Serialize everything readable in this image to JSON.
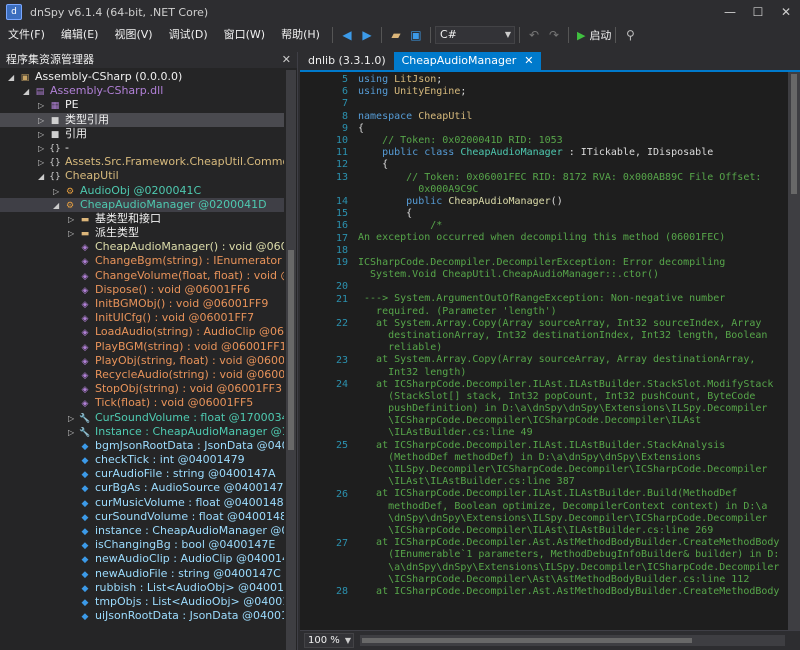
{
  "window": {
    "title": "dnSpy v6.1.4 (64-bit, .NET Core)"
  },
  "menu": [
    "文件(F)",
    "编辑(E)",
    "视图(V)",
    "调试(D)",
    "窗口(W)",
    "帮助(H)"
  ],
  "toolbar": {
    "language": "C#",
    "start_label": "启动"
  },
  "explorer": {
    "title": "程序集资源管理器",
    "rows": [
      {
        "indent": 0,
        "exp": "◢",
        "icon": "▣",
        "icon_color": "#c8a464",
        "text": "Assembly-CSharp (0.0.0.0)",
        "color": "#f1f1f1",
        "sel": false,
        "hl": false
      },
      {
        "indent": 1,
        "exp": "◢",
        "icon": "▤",
        "icon_color": "#b180d7",
        "text": "Assembly-CSharp.dll",
        "color": "#b180d7",
        "sel": false,
        "hl": false
      },
      {
        "indent": 2,
        "exp": "▷",
        "icon": "▦",
        "icon_color": "#b180d7",
        "text": "PE",
        "color": "#f1f1f1",
        "sel": false,
        "hl": false
      },
      {
        "indent": 2,
        "exp": "▷",
        "icon": "■",
        "icon_color": "#cfcfcf",
        "text": "类型引用",
        "color": "#f1f1f1",
        "sel": false,
        "hl": true
      },
      {
        "indent": 2,
        "exp": "▷",
        "icon": "■",
        "icon_color": "#cfcfcf",
        "text": "引用",
        "color": "#f1f1f1",
        "sel": false,
        "hl": false
      },
      {
        "indent": 2,
        "exp": "▷",
        "icon": "{}",
        "icon_color": "#cfcfcf",
        "text": "-",
        "color": "#f1f1f1",
        "sel": false,
        "hl": false
      },
      {
        "indent": 2,
        "exp": "▷",
        "icon": "{}",
        "icon_color": "#cfcfcf",
        "text": "Assets.Src.Framework.CheapUtil.Common.As",
        "color": "#d7ba7d",
        "sel": false,
        "hl": false
      },
      {
        "indent": 2,
        "exp": "◢",
        "icon": "{}",
        "icon_color": "#cfcfcf",
        "text": "CheapUtil",
        "color": "#d7ba7d",
        "sel": false,
        "hl": false
      },
      {
        "indent": 3,
        "exp": "▷",
        "icon": "⚙",
        "icon_color": "#e8a040",
        "text": "AudioObj @0200041C",
        "color": "#4ec9b0",
        "sel": false,
        "hl": false
      },
      {
        "indent": 3,
        "exp": "◢",
        "icon": "⚙",
        "icon_color": "#e8a040",
        "text": "CheapAudioManager @0200041D",
        "color": "#4ec9b0",
        "sel": true,
        "hl": false
      },
      {
        "indent": 4,
        "exp": "▷",
        "icon": "▬",
        "icon_color": "#dcb67a",
        "text": "基类型和接口",
        "color": "#f1f1f1",
        "sel": false,
        "hl": false
      },
      {
        "indent": 4,
        "exp": "▷",
        "icon": "▬",
        "icon_color": "#dcb67a",
        "text": "派生类型",
        "color": "#f1f1f1",
        "sel": false,
        "hl": false
      },
      {
        "indent": 4,
        "exp": "",
        "icon": "◈",
        "icon_color": "#b180d7",
        "text": "CheapAudioManager() : void @06001",
        "color": "#dcdcaa",
        "sel": false,
        "hl": false
      },
      {
        "indent": 4,
        "exp": "",
        "icon": "◈",
        "icon_color": "#b180d7",
        "text": "ChangeBgm(string) : IEnumerator @06",
        "color": "#e8935a",
        "sel": false,
        "hl": false
      },
      {
        "indent": 4,
        "exp": "",
        "icon": "◈",
        "icon_color": "#b180d7",
        "text": "ChangeVolume(float, float) : void @06",
        "color": "#e8935a",
        "sel": false,
        "hl": false
      },
      {
        "indent": 4,
        "exp": "",
        "icon": "◈",
        "icon_color": "#b180d7",
        "text": "Dispose() : void @06001FF6",
        "color": "#e8935a",
        "sel": false,
        "hl": false
      },
      {
        "indent": 4,
        "exp": "",
        "icon": "◈",
        "icon_color": "#b180d7",
        "text": "InitBGMObj() : void @06001FF9",
        "color": "#e8935a",
        "sel": false,
        "hl": false
      },
      {
        "indent": 4,
        "exp": "",
        "icon": "◈",
        "icon_color": "#b180d7",
        "text": "InitUICfg() : void @06001FF7",
        "color": "#e8935a",
        "sel": false,
        "hl": false
      },
      {
        "indent": 4,
        "exp": "",
        "icon": "◈",
        "icon_color": "#b180d7",
        "text": "LoadAudio(string) : AudioClip @06001",
        "color": "#e8935a",
        "sel": false,
        "hl": false
      },
      {
        "indent": 4,
        "exp": "",
        "icon": "◈",
        "icon_color": "#b180d7",
        "text": "PlayBGM(string) : void @06001FF1",
        "color": "#e8935a",
        "sel": false,
        "hl": false
      },
      {
        "indent": 4,
        "exp": "",
        "icon": "◈",
        "icon_color": "#b180d7",
        "text": "PlayObj(string, float) : void @06001FF",
        "color": "#e8935a",
        "sel": false,
        "hl": false
      },
      {
        "indent": 4,
        "exp": "",
        "icon": "◈",
        "icon_color": "#b180d7",
        "text": "RecycleAudio(string) : void @06001FE",
        "color": "#e8935a",
        "sel": false,
        "hl": false
      },
      {
        "indent": 4,
        "exp": "",
        "icon": "◈",
        "icon_color": "#b180d7",
        "text": "StopObj(string) : void @06001FF3",
        "color": "#e8935a",
        "sel": false,
        "hl": false
      },
      {
        "indent": 4,
        "exp": "",
        "icon": "◈",
        "icon_color": "#b180d7",
        "text": "Tick(float) : void @06001FF5",
        "color": "#e8935a",
        "sel": false,
        "hl": false
      },
      {
        "indent": 4,
        "exp": "▷",
        "icon": "🔧",
        "icon_color": "#cfcfcf",
        "text": "CurSoundVolume : float @1700034F",
        "color": "#4ec9b0",
        "sel": false,
        "hl": false
      },
      {
        "indent": 4,
        "exp": "▷",
        "icon": "🔧",
        "icon_color": "#cfcfcf",
        "text": "Instance : CheapAudioManager @170",
        "color": "#4ec9b0",
        "sel": false,
        "hl": false
      },
      {
        "indent": 4,
        "exp": "",
        "icon": "◆",
        "icon_color": "#3c9ae8",
        "text": "bgmJsonRootData : JsonData @0400",
        "color": "#9cdcfe",
        "sel": false,
        "hl": false
      },
      {
        "indent": 4,
        "exp": "",
        "icon": "◆",
        "icon_color": "#3c9ae8",
        "text": "checkTick : int @04001479",
        "color": "#9cdcfe",
        "sel": false,
        "hl": false
      },
      {
        "indent": 4,
        "exp": "",
        "icon": "◆",
        "icon_color": "#3c9ae8",
        "text": "curAudioFile : string @0400147A",
        "color": "#9cdcfe",
        "sel": false,
        "hl": false
      },
      {
        "indent": 4,
        "exp": "",
        "icon": "◆",
        "icon_color": "#3c9ae8",
        "text": "curBgAs : AudioSource @0400147B",
        "color": "#9cdcfe",
        "sel": false,
        "hl": false
      },
      {
        "indent": 4,
        "exp": "",
        "icon": "◆",
        "icon_color": "#3c9ae8",
        "text": "curMusicVolume : float @04001481",
        "color": "#9cdcfe",
        "sel": false,
        "hl": false
      },
      {
        "indent": 4,
        "exp": "",
        "icon": "◆",
        "icon_color": "#3c9ae8",
        "text": "curSoundVolume : float @04001482",
        "color": "#9cdcfe",
        "sel": false,
        "hl": false
      },
      {
        "indent": 4,
        "exp": "",
        "icon": "◆",
        "icon_color": "#3c9ae8",
        "text": "instance : CheapAudioManager @0400",
        "color": "#9cdcfe",
        "sel": false,
        "hl": false
      },
      {
        "indent": 4,
        "exp": "",
        "icon": "◆",
        "icon_color": "#3c9ae8",
        "text": "isChangingBg : bool @0400147E",
        "color": "#9cdcfe",
        "sel": false,
        "hl": false
      },
      {
        "indent": 4,
        "exp": "",
        "icon": "◆",
        "icon_color": "#3c9ae8",
        "text": "newAudioClip : AudioClip @0400147D",
        "color": "#9cdcfe",
        "sel": false,
        "hl": false
      },
      {
        "indent": 4,
        "exp": "",
        "icon": "◆",
        "icon_color": "#3c9ae8",
        "text": "newAudioFile : string @0400147C",
        "color": "#9cdcfe",
        "sel": false,
        "hl": false
      },
      {
        "indent": 4,
        "exp": "",
        "icon": "◆",
        "icon_color": "#3c9ae8",
        "text": "rubbish : List<AudioObj> @04001477",
        "color": "#9cdcfe",
        "sel": false,
        "hl": false
      },
      {
        "indent": 4,
        "exp": "",
        "icon": "◆",
        "icon_color": "#3c9ae8",
        "text": "tmpObjs : List<AudioObj> @0400147",
        "color": "#9cdcfe",
        "sel": false,
        "hl": false
      },
      {
        "indent": 4,
        "exp": "",
        "icon": "◆",
        "icon_color": "#3c9ae8",
        "text": "uiJsonRootData : JsonData @04001",
        "color": "#9cdcfe",
        "sel": false,
        "hl": false
      }
    ]
  },
  "tabs": [
    {
      "label": "dnlib (3.3.1.0)",
      "active": false
    },
    {
      "label": "CheapAudioManager",
      "active": true,
      "close": "✕"
    }
  ],
  "code": [
    {
      "ln": "5",
      "segs": [
        {
          "t": "using ",
          "c": "#569cd6"
        },
        {
          "t": "LitJson",
          "c": "#d7ba7d"
        },
        {
          "t": ";",
          "c": "#dcdcdc"
        }
      ]
    },
    {
      "ln": "6",
      "segs": [
        {
          "t": "using ",
          "c": "#569cd6"
        },
        {
          "t": "UnityEngine",
          "c": "#d7ba7d"
        },
        {
          "t": ";",
          "c": "#dcdcdc"
        }
      ]
    },
    {
      "ln": "7",
      "segs": []
    },
    {
      "ln": "8",
      "segs": [
        {
          "t": "namespace ",
          "c": "#569cd6"
        },
        {
          "t": "CheapUtil",
          "c": "#d7ba7d"
        }
      ]
    },
    {
      "ln": "9",
      "segs": [
        {
          "t": "{",
          "c": "#dcdcdc"
        }
      ]
    },
    {
      "ln": "10",
      "segs": [
        {
          "t": "    // Token: 0x0200041D RID: 1053",
          "c": "#57a64a"
        }
      ]
    },
    {
      "ln": "11",
      "segs": [
        {
          "t": "    public class ",
          "c": "#569cd6"
        },
        {
          "t": "CheapAudioManager",
          "c": "#4ec9b0"
        },
        {
          "t": " : ITickable, IDisposable",
          "c": "#dcdcdc"
        }
      ]
    },
    {
      "ln": "12",
      "segs": [
        {
          "t": "    {",
          "c": "#dcdcdc"
        }
      ]
    },
    {
      "ln": "13",
      "segs": [
        {
          "t": "        // Token: 0x06001FEC RID: 8172 RVA: 0x000AB89C File Offset:",
          "c": "#57a64a"
        }
      ]
    },
    {
      "ln": "",
      "segs": [
        {
          "t": "          0x000A9C9C",
          "c": "#57a64a"
        }
      ]
    },
    {
      "ln": "14",
      "segs": [
        {
          "t": "        public ",
          "c": "#569cd6"
        },
        {
          "t": "CheapAudioManager",
          "c": "#dcdcaa"
        },
        {
          "t": "()",
          "c": "#dcdcdc"
        }
      ]
    },
    {
      "ln": "15",
      "segs": [
        {
          "t": "        {",
          "c": "#dcdcdc"
        }
      ]
    },
    {
      "ln": "16",
      "segs": [
        {
          "t": "            /*",
          "c": "#57a64a"
        }
      ]
    },
    {
      "ln": "17",
      "segs": [
        {
          "t": "An exception occurred when decompiling this method (06001FEC)",
          "c": "#57a64a"
        }
      ]
    },
    {
      "ln": "18",
      "segs": []
    },
    {
      "ln": "19",
      "segs": [
        {
          "t": "ICSharpCode.Decompiler.DecompilerException: Error decompiling",
          "c": "#57a64a"
        }
      ]
    },
    {
      "ln": "",
      "segs": [
        {
          "t": "  System.Void CheapUtil.CheapAudioManager::.ctor()",
          "c": "#57a64a"
        }
      ]
    },
    {
      "ln": "20",
      "segs": []
    },
    {
      "ln": "21",
      "segs": [
        {
          "t": " ---> System.ArgumentOutOfRangeException: Non-negative number",
          "c": "#57a64a"
        }
      ]
    },
    {
      "ln": "",
      "segs": [
        {
          "t": "   required. (Parameter 'length')",
          "c": "#57a64a"
        }
      ]
    },
    {
      "ln": "22",
      "segs": [
        {
          "t": "   at System.Array.Copy(Array sourceArray, Int32 sourceIndex, Array",
          "c": "#57a64a"
        }
      ]
    },
    {
      "ln": "",
      "segs": [
        {
          "t": "     destinationArray, Int32 destinationIndex, Int32 length, Boolean",
          "c": "#57a64a"
        }
      ]
    },
    {
      "ln": "",
      "segs": [
        {
          "t": "     reliable)",
          "c": "#57a64a"
        }
      ]
    },
    {
      "ln": "23",
      "segs": [
        {
          "t": "   at System.Array.Copy(Array sourceArray, Array destinationArray,",
          "c": "#57a64a"
        }
      ]
    },
    {
      "ln": "",
      "segs": [
        {
          "t": "     Int32 length)",
          "c": "#57a64a"
        }
      ]
    },
    {
      "ln": "24",
      "segs": [
        {
          "t": "   at ICSharpCode.Decompiler.ILAst.ILAstBuilder.StackSlot.ModifyStack",
          "c": "#57a64a"
        }
      ]
    },
    {
      "ln": "",
      "segs": [
        {
          "t": "     (StackSlot[] stack, Int32 popCount, Int32 pushCount, ByteCode",
          "c": "#57a64a"
        }
      ]
    },
    {
      "ln": "",
      "segs": [
        {
          "t": "     pushDefinition) in D:\\a\\dnSpy\\dnSpy\\Extensions\\ILSpy.Decompiler",
          "c": "#57a64a"
        }
      ]
    },
    {
      "ln": "",
      "segs": [
        {
          "t": "     \\ICSharpCode.Decompiler\\ICSharpCode.Decompiler\\ILAst",
          "c": "#57a64a"
        }
      ]
    },
    {
      "ln": "",
      "segs": [
        {
          "t": "     \\ILAstBuilder.cs:line 49",
          "c": "#57a64a"
        }
      ]
    },
    {
      "ln": "25",
      "segs": [
        {
          "t": "   at ICSharpCode.Decompiler.ILAst.ILAstBuilder.StackAnalysis",
          "c": "#57a64a"
        }
      ]
    },
    {
      "ln": "",
      "segs": [
        {
          "t": "     (MethodDef methodDef) in D:\\a\\dnSpy\\dnSpy\\Extensions",
          "c": "#57a64a"
        }
      ]
    },
    {
      "ln": "",
      "segs": [
        {
          "t": "     \\ILSpy.Decompiler\\ICSharpCode.Decompiler\\ICSharpCode.Decompiler",
          "c": "#57a64a"
        }
      ]
    },
    {
      "ln": "",
      "segs": [
        {
          "t": "     \\ILAst\\ILAstBuilder.cs:line 387",
          "c": "#57a64a"
        }
      ]
    },
    {
      "ln": "26",
      "segs": [
        {
          "t": "   at ICSharpCode.Decompiler.ILAst.ILAstBuilder.Build(MethodDef",
          "c": "#57a64a"
        }
      ]
    },
    {
      "ln": "",
      "segs": [
        {
          "t": "     methodDef, Boolean optimize, DecompilerContext context) in D:\\a",
          "c": "#57a64a"
        }
      ]
    },
    {
      "ln": "",
      "segs": [
        {
          "t": "     \\dnSpy\\dnSpy\\Extensions\\ILSpy.Decompiler\\ICSharpCode.Decompiler",
          "c": "#57a64a"
        }
      ]
    },
    {
      "ln": "",
      "segs": [
        {
          "t": "     \\ICSharpCode.Decompiler\\ILAst\\ILAstBuilder.cs:line 269",
          "c": "#57a64a"
        }
      ]
    },
    {
      "ln": "27",
      "segs": [
        {
          "t": "   at ICSharpCode.Decompiler.Ast.AstMethodBodyBuilder.CreateMethodBody",
          "c": "#57a64a"
        }
      ]
    },
    {
      "ln": "",
      "segs": [
        {
          "t": "     (IEnumerable`1 parameters, MethodDebugInfoBuilder& builder) in D:",
          "c": "#57a64a"
        }
      ]
    },
    {
      "ln": "",
      "segs": [
        {
          "t": "     \\a\\dnSpy\\dnSpy\\Extensions\\ILSpy.Decompiler\\ICSharpCode.Decompiler",
          "c": "#57a64a"
        }
      ]
    },
    {
      "ln": "",
      "segs": [
        {
          "t": "     \\ICSharpCode.Decompiler\\Ast\\AstMethodBodyBuilder.cs:line 112",
          "c": "#57a64a"
        }
      ]
    },
    {
      "ln": "28",
      "segs": [
        {
          "t": "   at ICSharpCode.Decompiler.Ast.AstMethodBodyBuilder.CreateMethodBody",
          "c": "#57a64a"
        }
      ]
    }
  ],
  "status": {
    "zoom": "100 %"
  }
}
